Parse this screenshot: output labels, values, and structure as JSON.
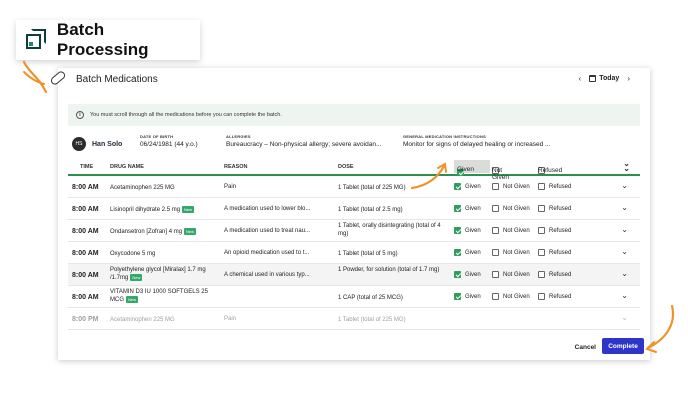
{
  "callout": {
    "title": "Batch Processing"
  },
  "header": {
    "title": "Batch Medications",
    "today_label": "Today"
  },
  "info": {
    "message": "You must scroll through all the medications before you can complete the batch."
  },
  "patient": {
    "initials": "HS",
    "name": "Han Solo",
    "dob_label": "DATE OF BIRTH",
    "dob_value": "06/24/1981 (44 y.o.)",
    "allergies_label": "ALLERGIES",
    "allergies_value": "Bureaucracy – Non-physical allergy; severe avoidan...",
    "instructions_label": "GENERAL MEDICATION INSTRUCTIONS",
    "instructions_value": "Monitor for signs of delayed healing or increased ..."
  },
  "table": {
    "headers": {
      "time": "TIME",
      "drug": "DRUG NAME",
      "reason": "REASON",
      "dose": "DOSE"
    },
    "status_labels": {
      "given": "Given",
      "not_given": "Not Given",
      "refused": "Refused"
    },
    "rows": [
      {
        "time": "8:00 AM",
        "drug": "Acetaminophen 225 MG",
        "badge": "",
        "reason": "Pain",
        "dose": "1 Tablet (total of 225 MG)"
      },
      {
        "time": "8:00 AM",
        "drug": "Lisinopril dihydrate 2.5 mg",
        "badge": "New",
        "reason": "A medication used to lower blo...",
        "dose": "1 Tablet (total of 2.5 mg)"
      },
      {
        "time": "8:00 AM",
        "drug": "Ondansetron [Zofran] 4 mg",
        "badge": "New",
        "reason": "A medication used to treat nau...",
        "dose": "1 Tablet, orally disintegrating (total of 4 mg)"
      },
      {
        "time": "8:00 AM",
        "drug": "Oxycodone 5 mg",
        "badge": "",
        "reason": "An opioid medication used to t...",
        "dose": "1 Tablet (total of 5 mg)"
      },
      {
        "time": "8:00 AM",
        "drug": "Polyethylene glycol [Miralax] 1.7 mg /1.7mg",
        "badge": "New",
        "reason": "A chemical used in various typ...",
        "dose": "1 Powder, for solution (total of 1.7 mg)"
      },
      {
        "time": "8:00 AM",
        "drug": "VITAMIN D3 IU 1000 SOFTGELS 25 MCG",
        "badge": "New",
        "reason": "",
        "dose": "1 CAP (total of 25 MCG)"
      },
      {
        "time": "8:00 PM",
        "drug": "Acetaminophen 225 MG",
        "badge": "",
        "reason": "Pain",
        "dose": "1 Tablet (total of 225 MG)"
      }
    ]
  },
  "footer": {
    "cancel_label": "Cancel",
    "complete_label": "Complete"
  },
  "colors": {
    "accent_green": "#2e9e5b",
    "complete_blue": "#2d36c8",
    "annotation_orange": "#f0922b"
  }
}
